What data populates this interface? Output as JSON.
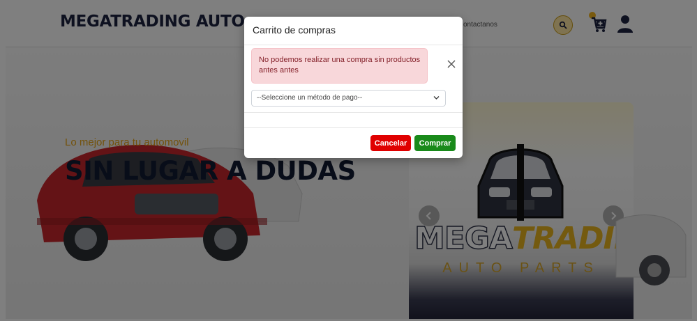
{
  "header": {
    "brand": "MEGATRADING AUTO",
    "nav_contact": "ontactanos",
    "icons": [
      "search-icon",
      "cart-add-icon",
      "user-icon"
    ],
    "accent_color": "#f3b51c"
  },
  "hero": {
    "tagline": "Lo mejor para tu automovil",
    "headline": "SIN LUGAR A DUDAS"
  },
  "carousel": {
    "logo_word_1": "MEGA",
    "logo_word_2": "TRADING",
    "logo_sub": "AUTO PARTS",
    "icons": [
      "chevron-left-icon",
      "chevron-right-icon"
    ]
  },
  "modal": {
    "title": "Carrito de compras",
    "alert_text": "No podemos realizar una compra sin productos antes antes",
    "payment_select_value": "--Seleccione un método de pago--",
    "cancel_label": "Cancelar",
    "buy_label": "Comprar",
    "colors": {
      "alert_bg": "#f8d7da",
      "alert_text": "#842029",
      "cancel": "#e00000",
      "buy": "#198a1a"
    }
  }
}
